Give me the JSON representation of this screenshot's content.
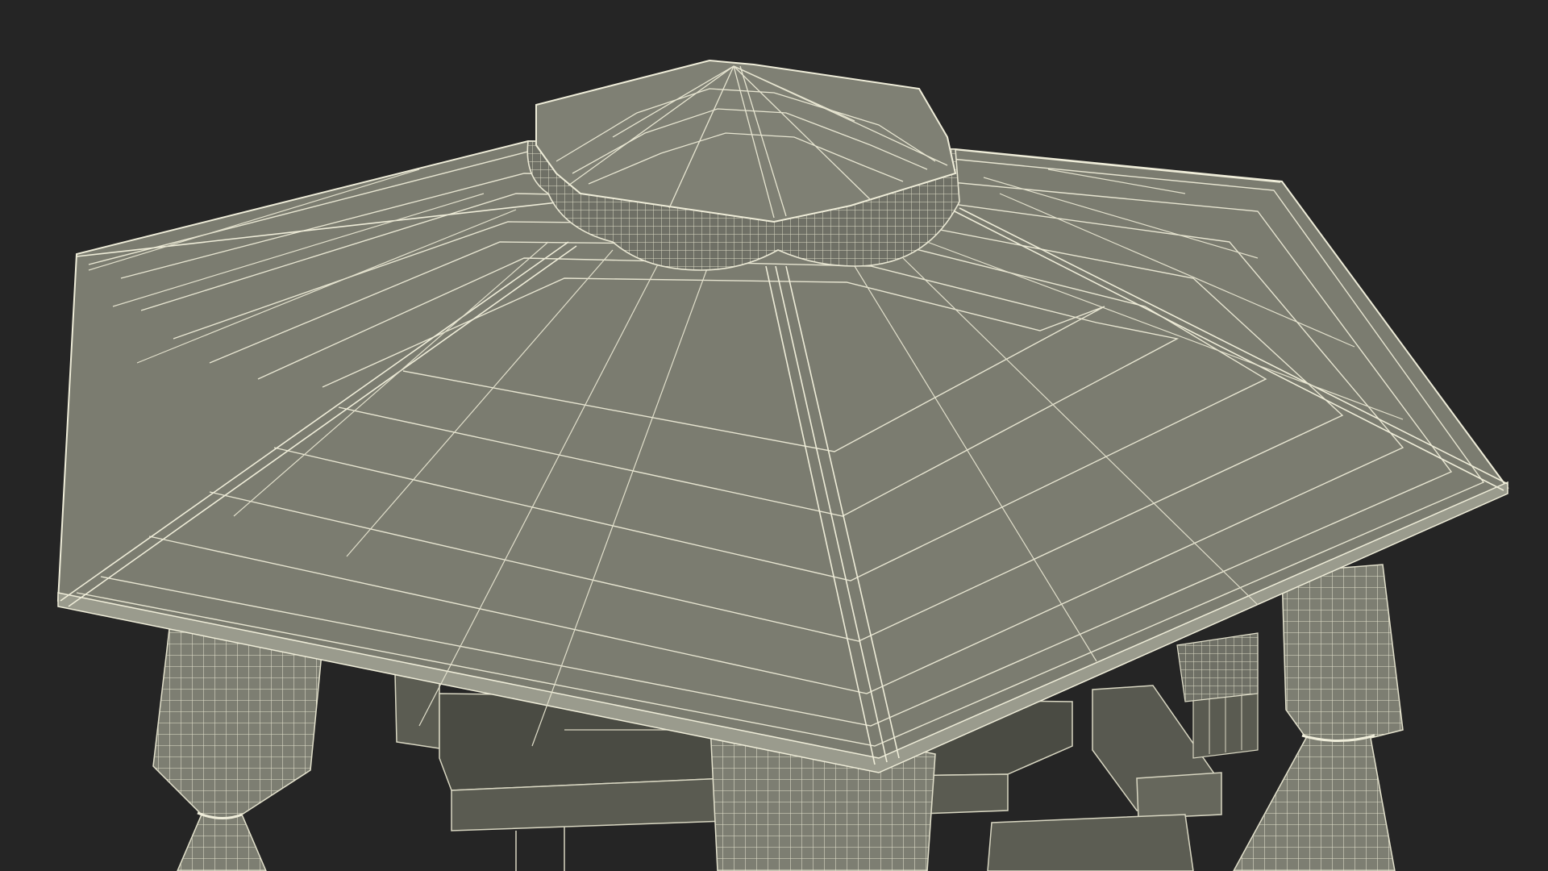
{
  "colors": {
    "background": "#252525",
    "roof_fill": "#7b7c70",
    "roof_fill_light": "#85867a",
    "roof_fill_dark": "#6a6b60",
    "wire": "#e9e7d3",
    "wire_soft": "#cfcdb8",
    "curtain_fill": "#7d7e72",
    "furniture_fill": "#5b5c52",
    "furniture_dark": "#3f403a"
  }
}
